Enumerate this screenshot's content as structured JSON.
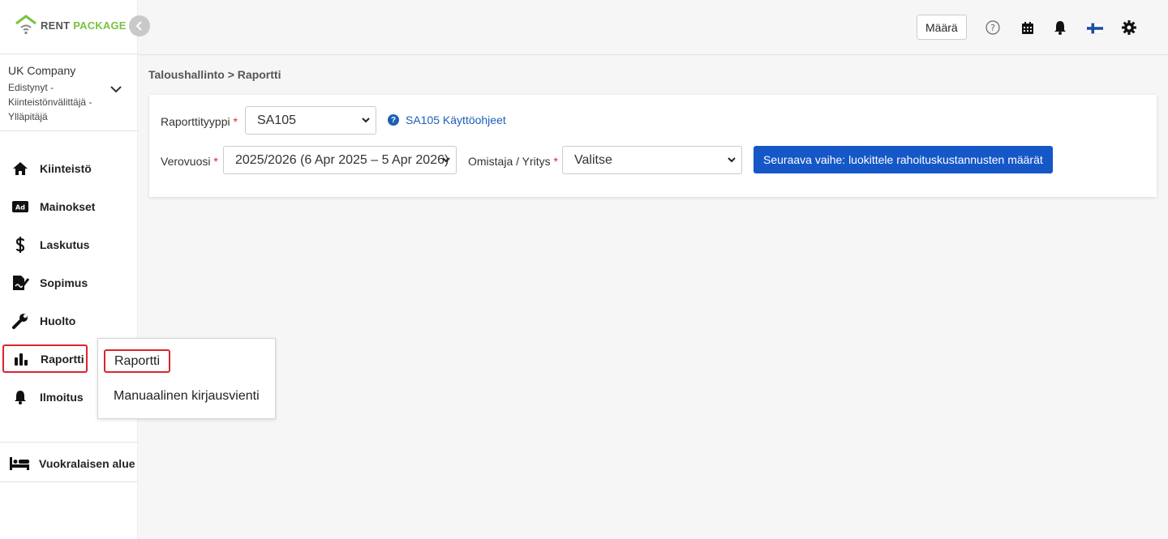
{
  "brand": {
    "rent": "RENT",
    "package": "PACKAGE"
  },
  "company": {
    "name": "UK Company",
    "role": "Edistynyt - Kiinteistönvälittäjä - Ylläpitäjä"
  },
  "nav": [
    {
      "label": "Kiinteistö",
      "icon": "home-icon"
    },
    {
      "label": "Mainokset",
      "icon": "ad-icon"
    },
    {
      "label": "Laskutus",
      "icon": "dollar-icon"
    },
    {
      "label": "Sopimus",
      "icon": "contract-icon"
    },
    {
      "label": "Huolto",
      "icon": "wrench-icon"
    },
    {
      "label": "Raportti",
      "icon": "chart-bar-icon"
    },
    {
      "label": "Ilmoitus",
      "icon": "bell-icon"
    }
  ],
  "tenant_area": {
    "label": "Vuokralaisen alue",
    "icon": "bed-icon"
  },
  "topbar": {
    "quantity_button": "Määrä"
  },
  "breadcrumb": "Taloushallinto > Raportti",
  "form": {
    "report_type_label": "Raporttityyppi",
    "report_type_value": "SA105",
    "help_link": "SA105 Käyttöohjeet",
    "tax_year_label": "Verovuosi",
    "tax_year_value": "2025/2026 (6 Apr 2025 – 5 Apr 2026)",
    "owner_label": "Omistaja / Yritys",
    "owner_value": "Valitse",
    "required_mark": "*",
    "next_button": "Seuraava vaihe: luokittele rahoituskustannusten määrät"
  },
  "submenu": {
    "items": [
      "Raportti",
      "Manuaalinen kirjausvienti"
    ]
  },
  "colors": {
    "accent": "#1557c7",
    "brand_green": "#7cc242",
    "highlight_red": "#d9262c"
  }
}
